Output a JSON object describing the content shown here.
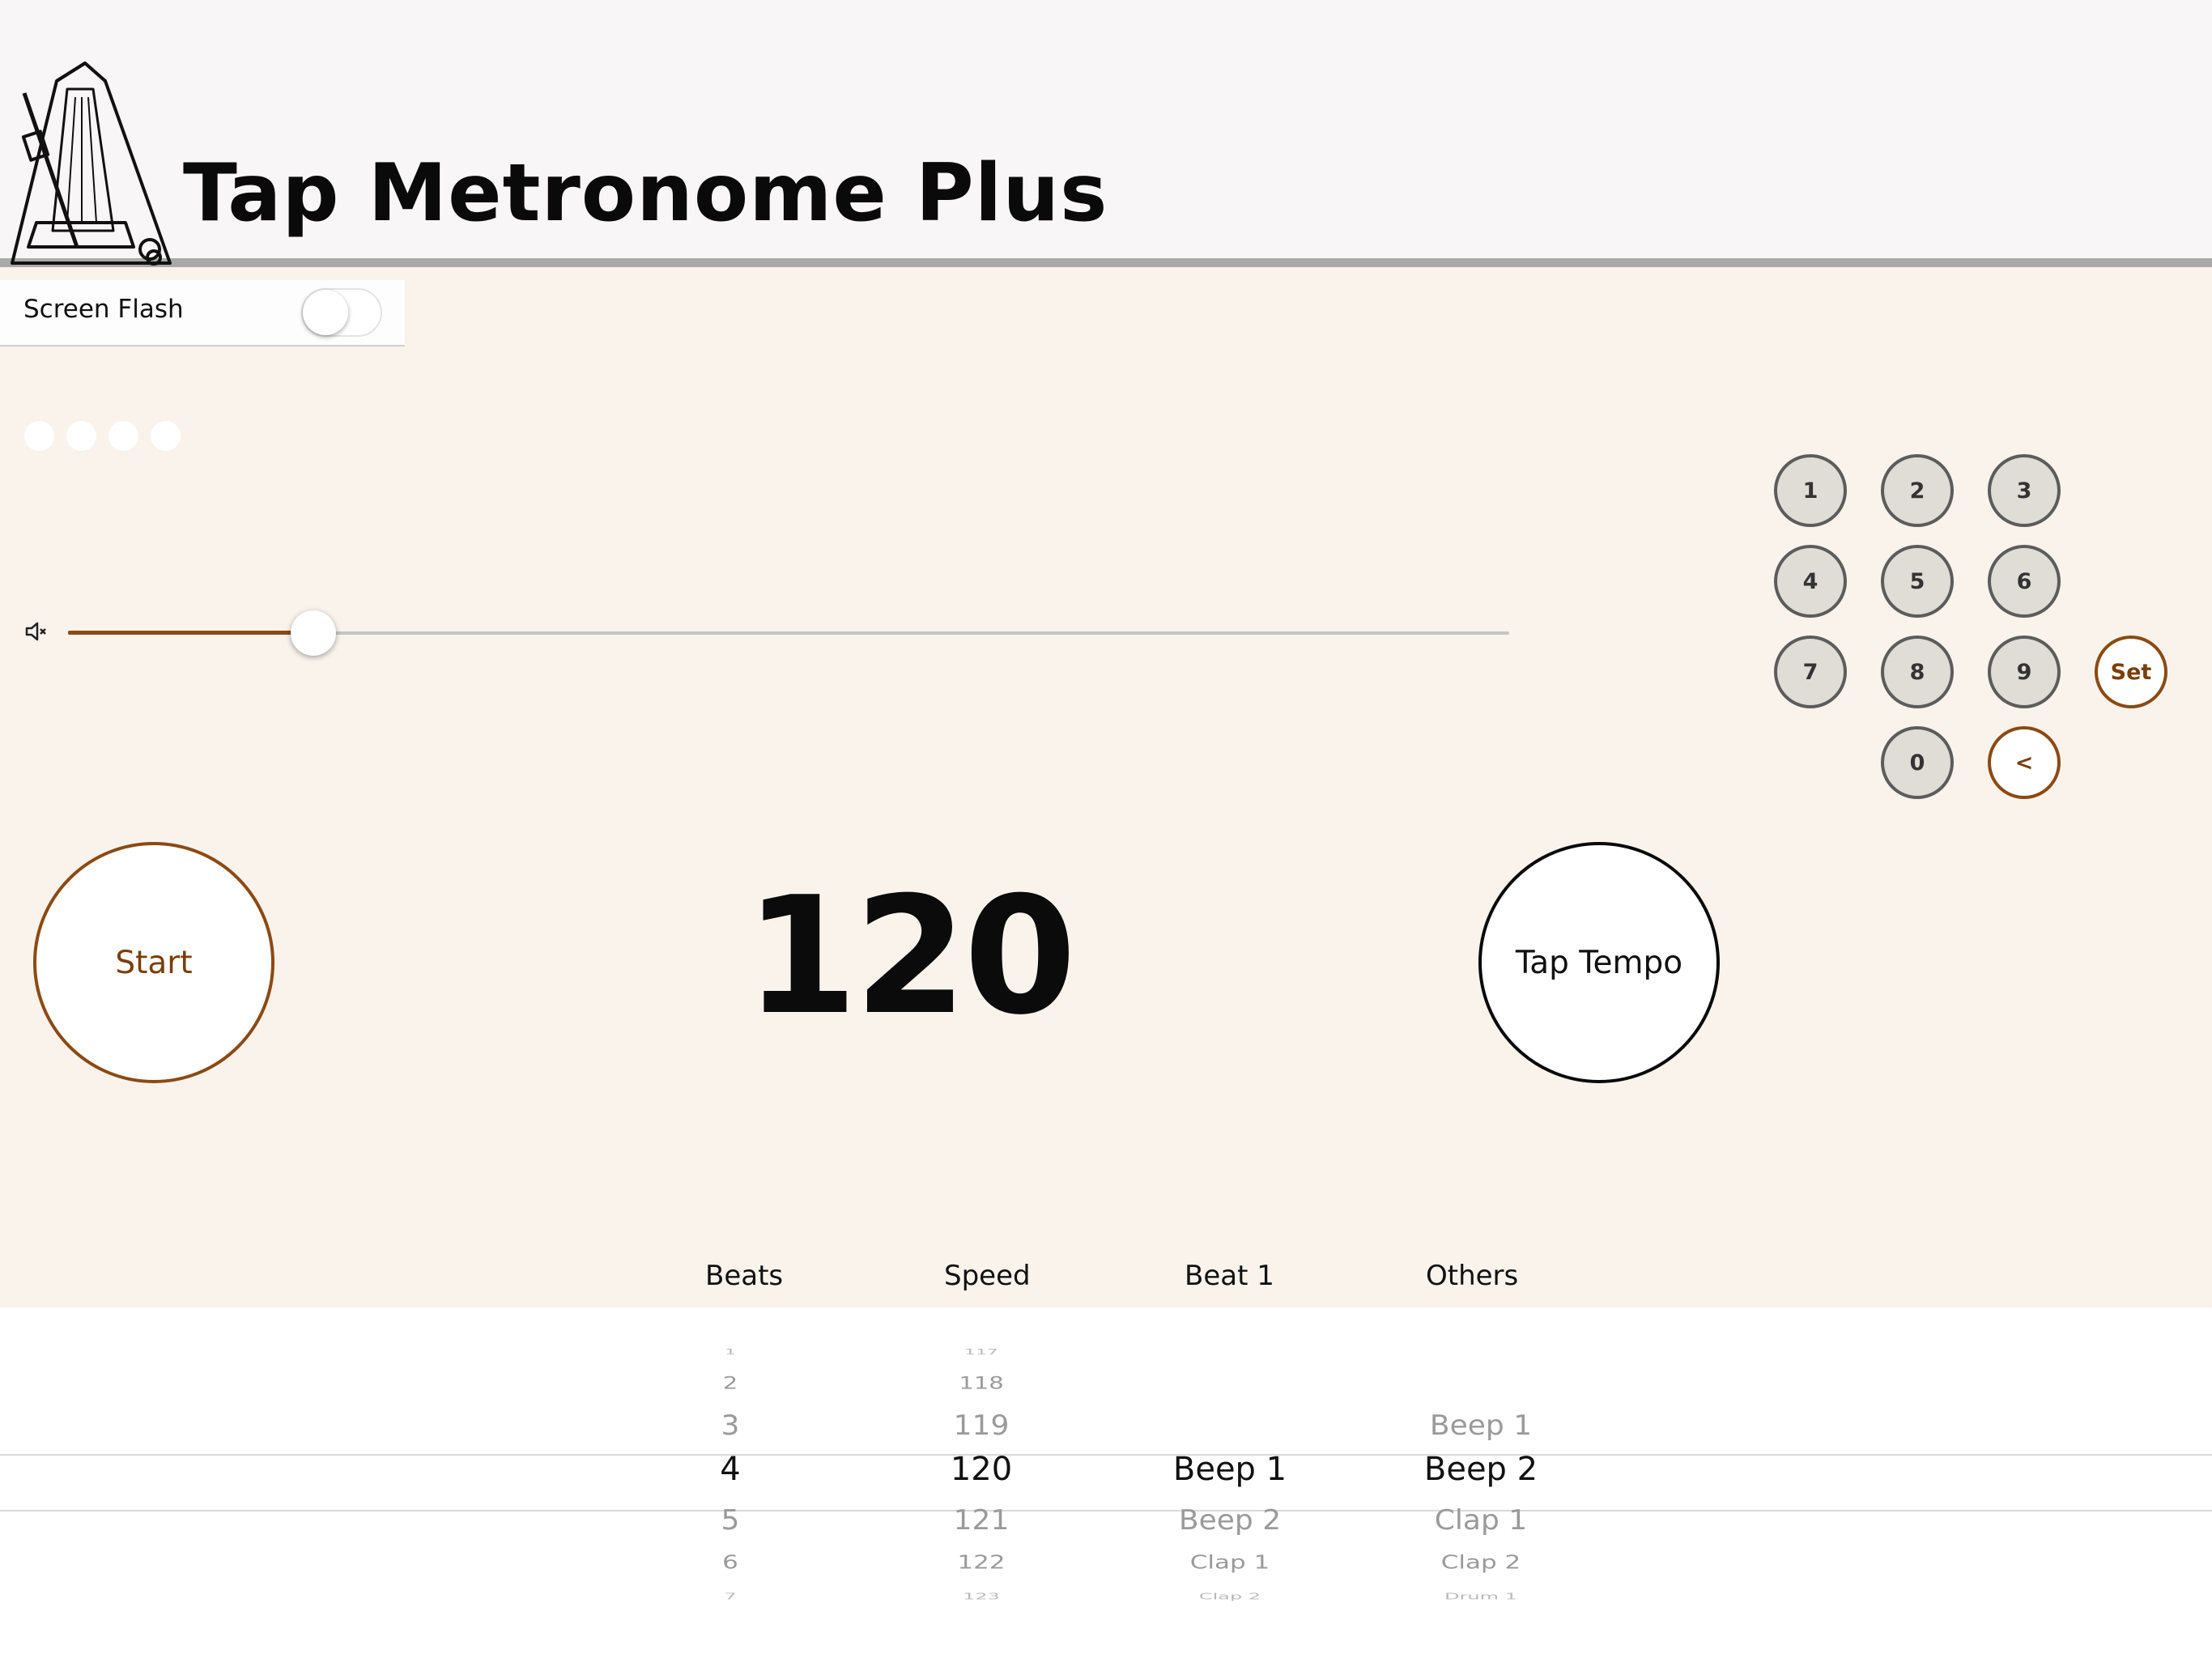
{
  "app": {
    "title": "Tap Metronome Plus",
    "accent_color": "#8b4a13",
    "background_color": "#f9f3ec"
  },
  "screen_flash": {
    "label": "Screen Flash",
    "on": false
  },
  "beat_indicator": {
    "count": 4
  },
  "volume": {
    "icon": "speaker-muted-icon",
    "level": 0.17
  },
  "keypad": {
    "keys": [
      "1",
      "2",
      "3",
      "4",
      "5",
      "6",
      "7",
      "8",
      "9",
      "0"
    ],
    "set_label": "Set",
    "backspace_label": "<"
  },
  "controls": {
    "start_label": "Start",
    "tap_label": "Tap Tempo",
    "bpm": "120"
  },
  "picker": {
    "headers": {
      "beats": "Beats",
      "speed": "Speed",
      "beat1": "Beat 1",
      "others": "Others"
    },
    "beats": [
      "1",
      "2",
      "3",
      "4",
      "5",
      "6",
      "7"
    ],
    "speed": [
      "117",
      "118",
      "119",
      "120",
      "121",
      "122",
      "123"
    ],
    "beat1": [
      "",
      "",
      "",
      "Beep 1",
      "Beep 2",
      "Clap 1",
      "Clap 2"
    ],
    "others": [
      "",
      "",
      "Beep 1",
      "Beep 2",
      "Clap 1",
      "Clap 2",
      "Drum 1"
    ],
    "selected_index": 3
  }
}
